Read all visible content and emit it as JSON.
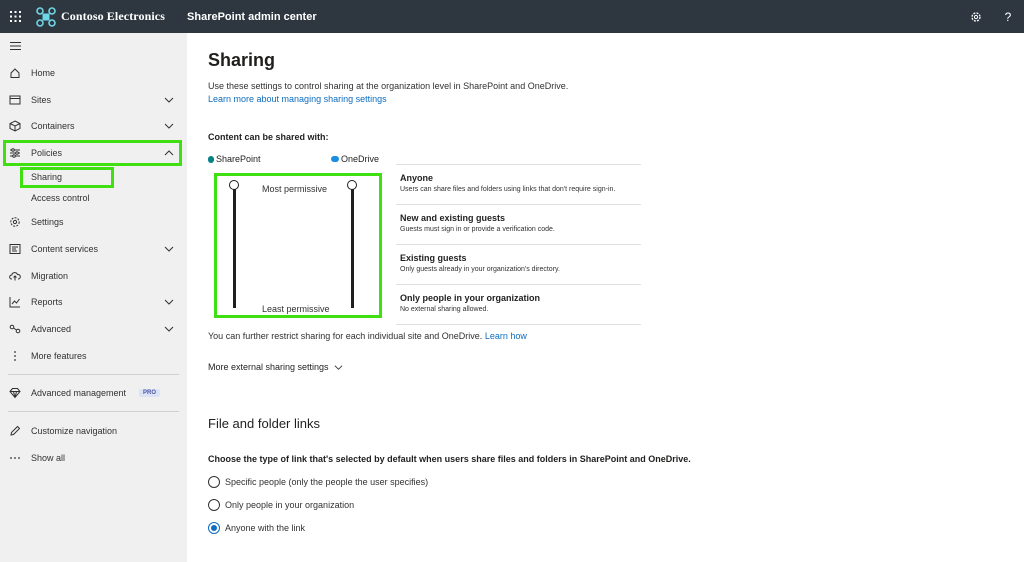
{
  "topbar": {
    "brand_name": "Contoso Electronics",
    "app_title": "SharePoint admin center",
    "icons": [
      "waffle-icon",
      "gear-icon",
      "help-icon"
    ],
    "help_label": "?",
    "bg_color": "#2e3740"
  },
  "sidebar": {
    "items": [
      {
        "label": "Home",
        "icon": "home-icon"
      },
      {
        "label": "Sites",
        "icon": "sites-icon",
        "expandable": true
      },
      {
        "label": "Containers",
        "icon": "containers-icon",
        "expandable": true
      },
      {
        "label": "Policies",
        "icon": "policies-icon",
        "expanded": true
      },
      {
        "label": "Settings",
        "icon": "gear-icon"
      },
      {
        "label": "Content services",
        "icon": "content-services-icon",
        "expandable": true
      },
      {
        "label": "Migration",
        "icon": "cloud-upload-icon"
      },
      {
        "label": "Reports",
        "icon": "chart-icon",
        "expandable": true
      },
      {
        "label": "Advanced",
        "icon": "advanced-icon",
        "expandable": true
      },
      {
        "label": "More features",
        "icon": "more-vertical-icon"
      },
      {
        "label": "Advanced management",
        "icon": "diamond-icon",
        "badge": "PRO"
      },
      {
        "label": "Customize navigation",
        "icon": "pencil-icon"
      },
      {
        "label": "Show all",
        "icon": "ellipsis-icon"
      }
    ],
    "sub_items": [
      {
        "label": "Sharing",
        "selected": true
      },
      {
        "label": "Access control"
      }
    ],
    "highlight_color": "#3ee011"
  },
  "main": {
    "title": "Sharing",
    "description": "Use these settings to control sharing at the organization level in SharePoint and OneDrive.",
    "learn_more": "Learn more about managing sharing settings",
    "content_label": "Content can be shared with:",
    "columns": [
      "SharePoint",
      "OneDrive"
    ],
    "slider_top_label": "Most permissive",
    "slider_bottom_label": "Least permissive",
    "levels": [
      {
        "title": "Anyone",
        "desc": "Users can share files and folders using links that don't require sign-in."
      },
      {
        "title": "New and existing guests",
        "desc": "Guests must sign in or provide a verification code."
      },
      {
        "title": "Existing guests",
        "desc": "Only guests already in your organization's directory."
      },
      {
        "title": "Only people in your organization",
        "desc": "No external sharing allowed."
      }
    ],
    "sharepoint_level": "Anyone",
    "onedrive_level": "Anyone",
    "restrict_text": "You can further restrict sharing for each individual site and OneDrive.",
    "restrict_link": "Learn how",
    "more_settings": "More external sharing settings",
    "section2_title": "File and folder links",
    "section2_desc": "Choose the type of link that's selected by default when users share files and folders in SharePoint and OneDrive.",
    "radio_options": [
      {
        "label": "Specific people (only the people the user specifies)",
        "checked": false
      },
      {
        "label": "Only people in your organization",
        "checked": false
      },
      {
        "label": "Anyone with the link",
        "checked": true
      }
    ],
    "link_color": "#0f6cbd"
  }
}
